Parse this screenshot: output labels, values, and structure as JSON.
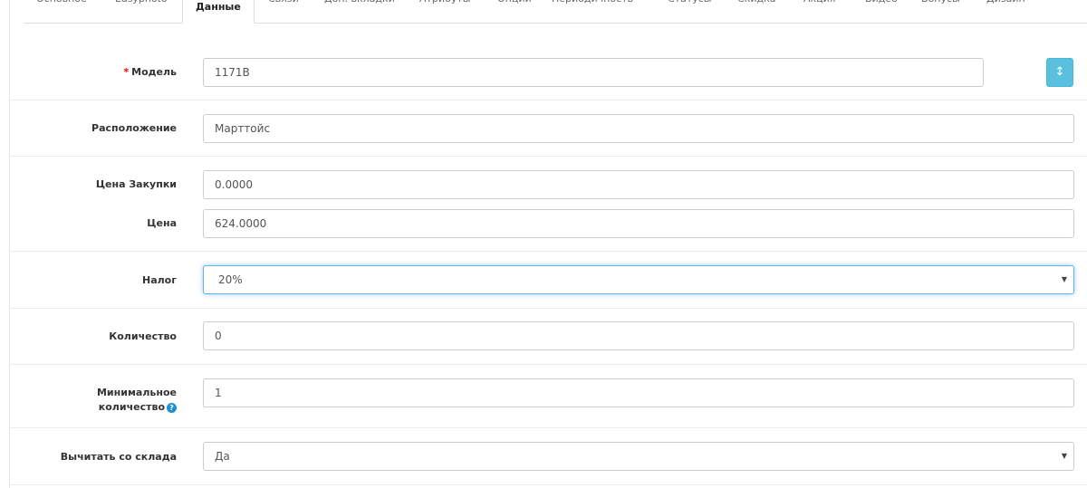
{
  "tabs": [
    {
      "label": "Основное"
    },
    {
      "label": "Easyphoto"
    },
    {
      "label": "Данные"
    },
    {
      "label": "Связи"
    },
    {
      "label": "Доп. вкладки"
    },
    {
      "label": "Атрибуты"
    },
    {
      "label": "Опции"
    },
    {
      "label": "Периодичность"
    },
    {
      "label": "Статусы"
    },
    {
      "label": "Скидка"
    },
    {
      "label": "Акция"
    },
    {
      "label": "Видео"
    },
    {
      "label": "Бонусы"
    },
    {
      "label": "Дизайн"
    }
  ],
  "active_tab": "Данные",
  "form": {
    "model": {
      "label": "Модель",
      "required_mark": "*",
      "value": "1171B"
    },
    "location": {
      "label": "Расположение",
      "value": "Марттойс"
    },
    "purchase_price": {
      "label": "Цена Закупки",
      "value": "0.0000"
    },
    "price": {
      "label": "Цена",
      "value": "624.0000"
    },
    "tax": {
      "label": "Налог",
      "value": "20%"
    },
    "quantity": {
      "label": "Количество",
      "value": "0"
    },
    "min_quantity": {
      "label_line1": "Минимальное",
      "label_line2": "количество",
      "value": "1"
    },
    "subtract": {
      "label": "Вычитать со склада",
      "value": "Да"
    }
  },
  "icons": {
    "generate_button_icon": "arrows-vertical-icon",
    "help_icon": "question-circle-icon",
    "dropdown_icon": "caret-down-icon"
  },
  "colors": {
    "accent": "#5bc0de",
    "required": "#ff0000",
    "help": "#1e91cf",
    "focus_border": "#66afe9"
  }
}
